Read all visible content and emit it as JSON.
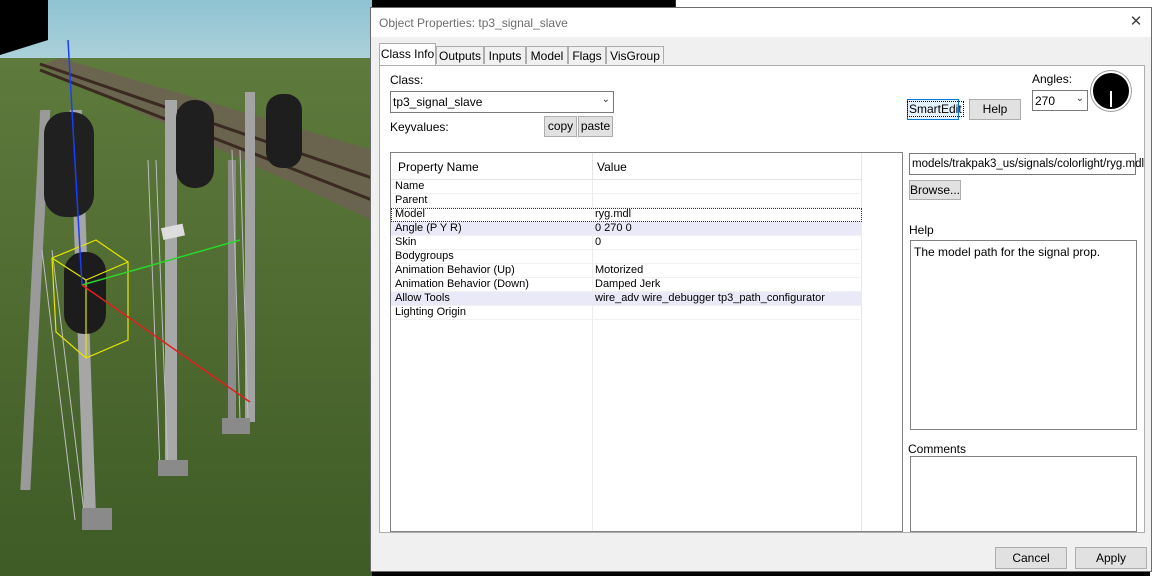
{
  "dialog": {
    "title": "Object Properties: tp3_signal_slave",
    "close_glyph": "✕"
  },
  "tabs": [
    {
      "label": "Class Info",
      "active": true
    },
    {
      "label": "Outputs"
    },
    {
      "label": "Inputs"
    },
    {
      "label": "Model"
    },
    {
      "label": "Flags"
    },
    {
      "label": "VisGroup"
    }
  ],
  "class_info": {
    "class_label": "Class:",
    "class_value": "tp3_signal_slave",
    "keyvalues_label": "Keyvalues:",
    "copy_label": "copy",
    "paste_label": "paste",
    "smartedit_label": "SmartEdit",
    "help_label": "Help",
    "angles_label": "Angles:",
    "angles_value": "270"
  },
  "grid": {
    "col_name": "Property Name",
    "col_value": "Value",
    "rows": [
      {
        "name": "Name",
        "value": ""
      },
      {
        "name": "Parent",
        "value": ""
      },
      {
        "name": "Model",
        "value": "ryg.mdl"
      },
      {
        "name": "Angle (P Y R)",
        "value": "0 270 0"
      },
      {
        "name": "Skin",
        "value": "0"
      },
      {
        "name": "Bodygroups",
        "value": ""
      },
      {
        "name": "Animation Behavior (Up)",
        "value": "Motorized"
      },
      {
        "name": "Animation Behavior (Down)",
        "value": "Damped Jerk"
      },
      {
        "name": "Allow Tools",
        "value": "wire_adv wire_debugger tp3_path_configurator"
      },
      {
        "name": "Lighting Origin",
        "value": ""
      }
    ]
  },
  "editor": {
    "value_text": "models/trakpak3_us/signals/colorlight/ryg.mdl",
    "browse_label": "Browse...",
    "help_label": "Help",
    "help_text": "The model path for the signal prop.",
    "comments_label": "Comments",
    "comments_text": ""
  },
  "footer": {
    "cancel_label": "Cancel",
    "apply_label": "Apply"
  }
}
